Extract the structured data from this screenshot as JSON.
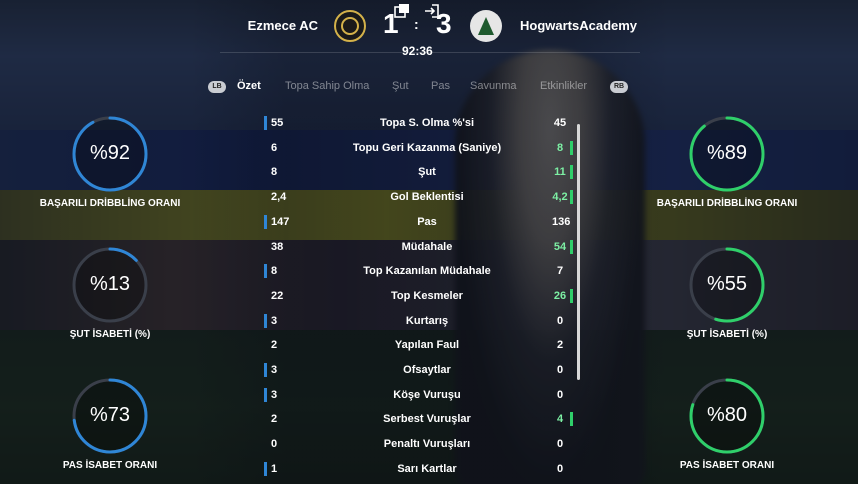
{
  "match": {
    "home_team": "Ezmece AC",
    "away_team": "HogwartsAcademy",
    "home_score": "1",
    "away_score": "3",
    "score_separator": ":",
    "clock": "92:36"
  },
  "tabs": {
    "left_button": "LB",
    "right_button": "RB",
    "items": [
      "Özet",
      "Topa Sahip Olma",
      "Şut",
      "Pas",
      "Savunma",
      "Etkinlikler"
    ],
    "active": "Özet"
  },
  "stats": [
    {
      "label": "Topa S. Olma %'si",
      "home": "55",
      "away": "45",
      "leader": "home"
    },
    {
      "label": "Topu Geri Kazanma (Saniye)",
      "home": "6",
      "away": "8",
      "leader": "away"
    },
    {
      "label": "Şut",
      "home": "8",
      "away": "11",
      "leader": "away"
    },
    {
      "label": "Gol Beklentisi",
      "home": "2,4",
      "away": "4,2",
      "leader": "away"
    },
    {
      "label": "Pas",
      "home": "147",
      "away": "136",
      "leader": "home"
    },
    {
      "label": "Müdahale",
      "home": "38",
      "away": "54",
      "leader": "away"
    },
    {
      "label": "Top Kazanılan Müdahale",
      "home": "8",
      "away": "7",
      "leader": "home"
    },
    {
      "label": "Top Kesmeler",
      "home": "22",
      "away": "26",
      "leader": "away"
    },
    {
      "label": "Kurtarış",
      "home": "3",
      "away": "0",
      "leader": "home"
    },
    {
      "label": "Yapılan Faul",
      "home": "2",
      "away": "2",
      "leader": "none"
    },
    {
      "label": "Ofsaytlar",
      "home": "3",
      "away": "0",
      "leader": "home"
    },
    {
      "label": "Köşe Vuruşu",
      "home": "3",
      "away": "0",
      "leader": "home"
    },
    {
      "label": "Serbest Vuruşlar",
      "home": "2",
      "away": "4",
      "leader": "away"
    },
    {
      "label": "Penaltı Vuruşları",
      "home": "0",
      "away": "0",
      "leader": "none"
    },
    {
      "label": "Sarı Kartlar",
      "home": "1",
      "away": "0",
      "leader": "home"
    }
  ],
  "gauges": {
    "home": [
      {
        "value_text": "%92",
        "value": 92,
        "caption": "BAŞARILI DRİBBLİNG ORANI"
      },
      {
        "value_text": "%13",
        "value": 13,
        "caption": "ŞUT İSABETİ (%)"
      },
      {
        "value_text": "%73",
        "value": 73,
        "caption": "PAS İSABET ORANI"
      }
    ],
    "away": [
      {
        "value_text": "%89",
        "value": 89,
        "caption": "BAŞARILI DRİBBLİNG ORANI"
      },
      {
        "value_text": "%55",
        "value": 55,
        "caption": "ŞUT İSABETİ (%)"
      },
      {
        "value_text": "%80",
        "value": 80,
        "caption": "PAS İSABET ORANI"
      }
    ]
  },
  "colors": {
    "home_accent": "#2f86d6",
    "away_accent": "#2fcf6a",
    "ring_track": "#3a3f4a"
  },
  "icons": {
    "popout": "popout-icon",
    "login": "login-icon",
    "home_crest": "ezmece-crest-icon",
    "away_crest": "hogwarts-crest-icon"
  }
}
